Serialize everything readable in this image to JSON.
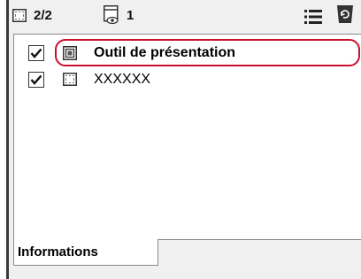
{
  "toolbar": {
    "layer_count": "2/2",
    "viewer_count": "1",
    "list_menu_icon": "list-menu-icon",
    "refresh_icon": "refresh-icon"
  },
  "list": {
    "items": [
      {
        "label": "Outil de présentation",
        "checked": true,
        "icon": "presentation-tool-icon",
        "bold": true,
        "highlighted": true
      },
      {
        "label": "XXXXXX",
        "checked": true,
        "icon": "layer-frame-icon",
        "bold": false,
        "highlighted": false
      }
    ]
  },
  "tabs": {
    "active_label": "Informations"
  },
  "colors": {
    "highlight": "#c8102e",
    "panel_bg": "#f0f0f0",
    "list_bg": "#ffffff"
  }
}
